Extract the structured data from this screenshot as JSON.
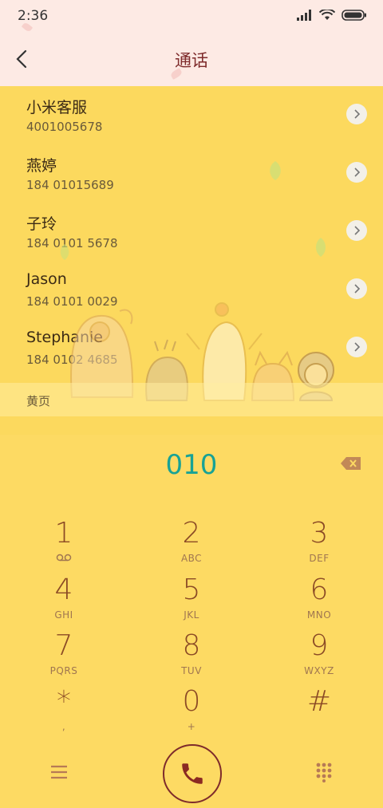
{
  "status": {
    "time": "2:36"
  },
  "header": {
    "title": "通话"
  },
  "contacts": [
    {
      "name": "小米客服",
      "number": "4001005678"
    },
    {
      "name": "燕婷",
      "number": "184 01015689"
    },
    {
      "name": "子玲",
      "number": "184 0101 5678"
    },
    {
      "name": "Jason",
      "number": "184 0101 0029"
    },
    {
      "name": "Stephanie",
      "number": "184 0102 4685"
    }
  ],
  "section": {
    "label": "黄页"
  },
  "dialer": {
    "number": "010",
    "keys": [
      {
        "digit": "1",
        "letters": "voicemail"
      },
      {
        "digit": "2",
        "letters": "ABC"
      },
      {
        "digit": "3",
        "letters": "DEF"
      },
      {
        "digit": "4",
        "letters": "GHI"
      },
      {
        "digit": "5",
        "letters": "JKL"
      },
      {
        "digit": "6",
        "letters": "MNO"
      },
      {
        "digit": "7",
        "letters": "PQRS"
      },
      {
        "digit": "8",
        "letters": "TUV"
      },
      {
        "digit": "9",
        "letters": "WXYZ"
      },
      {
        "digit": "*",
        "letters": ","
      },
      {
        "digit": "0",
        "letters": "+"
      },
      {
        "digit": "#",
        "letters": ""
      }
    ]
  },
  "colors": {
    "accent": "#18a295",
    "brand": "#7e2b2b",
    "background": "#fcd95e"
  }
}
